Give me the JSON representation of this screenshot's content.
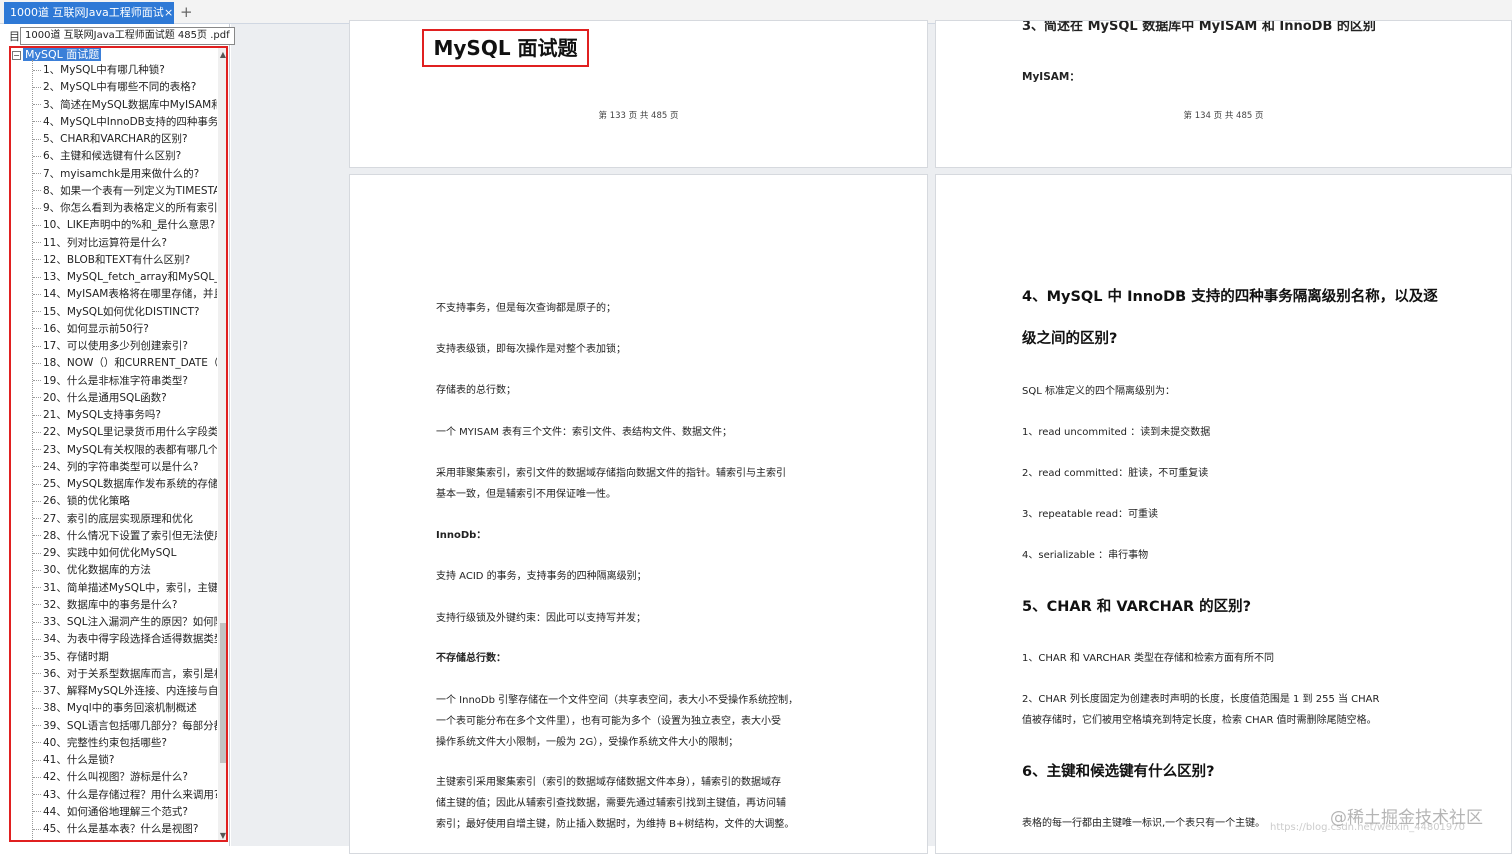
{
  "tab": {
    "title": "1000道 互联网Java工程师面试",
    "close": "×",
    "add": "+"
  },
  "sidebar": {
    "tooltip": "1000道 互联网Java工程师面试题 485页 .pdf",
    "root": "MySQL 面试题",
    "items": [
      "1、MySQL中有哪几种锁?",
      "2、MySQL中有哪些不同的表格?",
      "3、简述在MySQL数据库中MyISAM和",
      "4、MySQL中InnoDB支持的四种事务",
      "5、CHAR和VARCHAR的区别?",
      "6、主键和候选键有什么区别?",
      "7、myisamchk是用来做什么的?",
      "8、如果一个表有一列定义为TIMESTA",
      "9、你怎么看到为表格定义的所有索引",
      "10、LIKE声明中的%和_是什么意思?",
      "11、列对比运算符是什么?",
      "12、BLOB和TEXT有什么区别?",
      "13、MySQL_fetch_array和MySQL_fe",
      "14、MyISAM表格将在哪里存储，并且",
      "15、MySQL如何优化DISTINCT?",
      "16、如何显示前50行?",
      "17、可以使用多少列创建索引?",
      "18、NOW（）和CURRENT_DATE（",
      "19、什么是非标准字符串类型?",
      "20、什么是通用SQL函数?",
      "21、MySQL支持事务吗?",
      "22、MySQL里记录货币用什么字段类",
      "23、MySQL有关权限的表都有哪几个",
      "24、列的字符串类型可以是什么?",
      "25、MySQL数据库作发布系统的存储",
      "26、锁的优化策略",
      "27、索引的底层实现原理和优化",
      "28、什么情况下设置了索引但无法使用",
      "29、实践中如何优化MySQL",
      "30、优化数据库的方法",
      "31、简单描述MySQL中，索引，主键",
      "32、数据库中的事务是什么?",
      "33、SQL注入漏洞产生的原因？如何防",
      "34、为表中得字段选择合适得数据类型",
      "35、存储时期",
      "36、对于关系型数据库而言，索引是相",
      "37、解释MySQL外连接、内连接与自",
      "38、Myql中的事务回滚机制概述",
      "39、SQL语言包括哪几部分？每部分都",
      "40、完整性约束包括哪些?",
      "41、什么是锁?",
      "42、什么叫视图？游标是什么?",
      "43、什么是存储过程？用什么来调用?",
      "44、如何通俗地理解三个范式?",
      "45、什么是基本表？什么是视图?"
    ]
  },
  "page1": {
    "title": "MySQL  面试题",
    "page_no": "第 133 页 共 485 页"
  },
  "page2": {
    "heading_cut": "3、简述在 MySQL 数据库中 MyISAM 和 InnoDB 的区别",
    "label": "MyISAM：",
    "page_no": "第 134 页 共 485 页"
  },
  "page3": {
    "l1": "不支持事务，但是每次查询都是原子的；",
    "l2": "支持表级锁，即每次操作是对整个表加锁；",
    "l3": "存储表的总行数；",
    "l4": "一个 MYISAM 表有三个文件：索引文件、表结构文件、数据文件；",
    "l5a": "采用菲聚集索引，索引文件的数据域存储指向数据文件的指针。辅索引与主索引",
    "l5b": "基本一致，但是辅索引不用保证唯一性。",
    "innodb": "InnoDb：",
    "l6": "支持 ACID 的事务，支持事务的四种隔离级别；",
    "l7": "支持行级锁及外键约束：因此可以支持写并发；",
    "l8": "不存储总行数：",
    "l9a": "一个 InnoDb 引擎存储在一个文件空间（共享表空间，表大小不受操作系统控制，",
    "l9b": "一个表可能分布在多个文件里），也有可能为多个（设置为独立表空，表大小受",
    "l9c": "操作系统文件大小限制，一般为 2G），受操作系统文件大小的限制；",
    "l10a": "主键索引采用聚集索引（索引的数据域存储数据文件本身），辅索引的数据域存",
    "l10b": "储主键的值；因此从辅索引查找数据，需要先通过辅索引找到主键值，再访问辅",
    "l10c": "索引；最好使用自增主键，防止插入数据时，为维持 B+树结构，文件的大调整。"
  },
  "page4": {
    "h4a": "4、MySQL 中 InnoDB 支持的四种事务隔离级别名称，以及逐",
    "h4b": "级之间的区别?",
    "s1": "SQL 标准定义的四个隔离级别为：",
    "s2": "1、read uncommited ：读到未提交数据",
    "s3": "2、read committed：脏读，不可重复读",
    "s4": "3、repeatable read：可重读",
    "s5": "4、serializable ：串行事物",
    "h5": "5、CHAR 和 VARCHAR 的区别?",
    "c1": "1、CHAR 和 VARCHAR 类型在存储和检索方面有所不同",
    "c2a": "2、CHAR 列长度固定为创建表时声明的长度，长度值范围是 1 到 255 当 CHAR",
    "c2b": "值被存储时，它们被用空格填充到特定长度，检索 CHAR 值时需删除尾随空格。",
    "h6": "6、主键和候选键有什么区别?",
    "k1": "表格的每一行都由主键唯一标识,一个表只有一个主键。"
  },
  "watermark": {
    "text": "@稀土掘金技术社区",
    "url": "https://blog.csdn.net/weixin_44801970"
  }
}
